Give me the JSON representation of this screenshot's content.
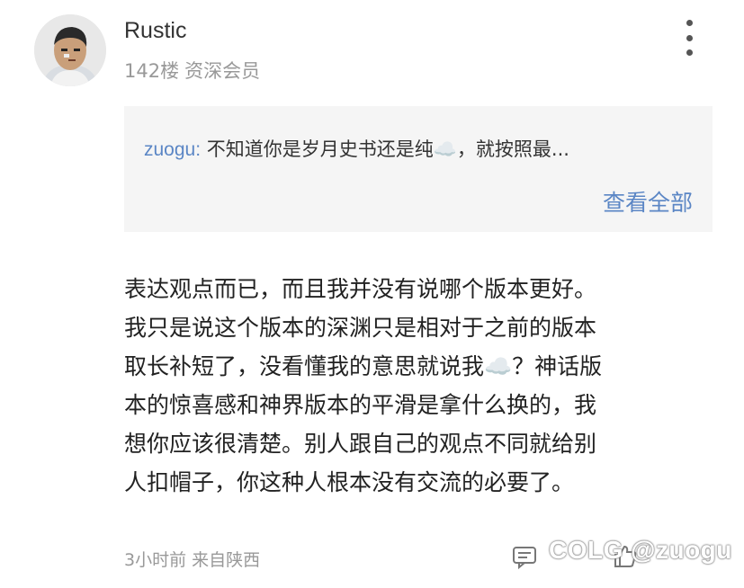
{
  "user": {
    "name": "Rustic",
    "floor": "142楼",
    "rank": "资深会员"
  },
  "quote": {
    "author": "zuogu:",
    "text": "不知道你是岁月史书还是纯☁️，就按照最...",
    "view_all": "查看全部"
  },
  "post": {
    "lines": [
      "表达观点而已，而且我并没有说哪个版本更好。",
      "我只是说这个版本的深渊只是相对于之前的版本",
      "取长补短了，没看懂我的意思就说我☁️？神话版",
      "本的惊喜感和神界版本的平滑是拿什么换的，我",
      "想你应该很清楚。别人跟自己的观点不同就给别",
      "人扣帽子，你这种人根本没有交流的必要了。"
    ]
  },
  "footer": {
    "time": "3小时前",
    "location": "来自陕西",
    "watermark": "COLG @zuogu"
  },
  "icons": {
    "more": "more-vertical-icon",
    "comment": "comment-icon",
    "like": "like-icon"
  }
}
